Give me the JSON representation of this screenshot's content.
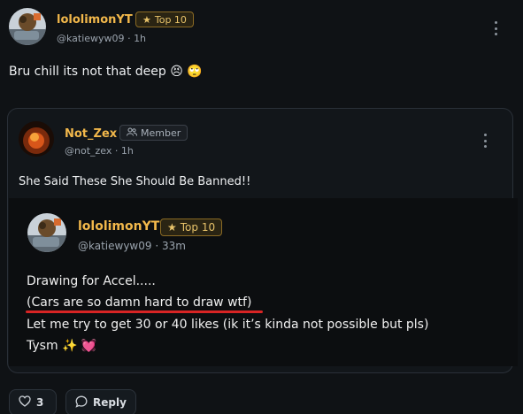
{
  "post": {
    "author": {
      "name": "lololimonYT",
      "badge_icon": "star-icon",
      "badge_label": "Top 10",
      "handle": "@katiewyw09",
      "time": "1h"
    },
    "text": "Bru chill its not that deep 😣 🙄"
  },
  "quote": {
    "author": {
      "name": "Not_Zex",
      "badge_icon": "member-icon",
      "badge_label": "Member",
      "handle": "@not_zex",
      "time": "1h"
    },
    "text": "She Said These She Should Be Banned!!",
    "screenshot": {
      "author": {
        "name": "lololimonYT",
        "badge_icon": "star-icon",
        "badge_label": "Top 10",
        "handle": "@katiewyw09",
        "time": "33m"
      },
      "lines": [
        "Drawing for Accel.....",
        "(Cars are so damn hard to draw wtf)",
        "Let me try to get 30 or 40 likes (ik it’s kinda not possible but pls)",
        "Tysm ✨ 💓"
      ],
      "underline_color": "#d82424"
    }
  },
  "actions": {
    "like_count": "3",
    "reply_label": "Reply"
  },
  "colors": {
    "background": "#0f1215",
    "username": "#f2b84b",
    "badge_gold": "#e8c36a",
    "muted": "#9aa3ad"
  }
}
